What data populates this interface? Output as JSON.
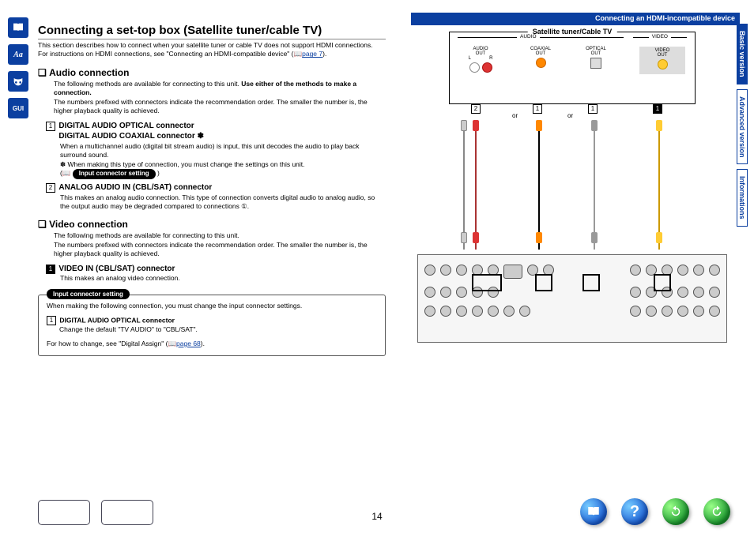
{
  "header": {
    "breadcrumb": "Connecting an HDMI-incompatible device"
  },
  "sidetabs": {
    "basic": "Basic version",
    "advanced": "Advanced version",
    "info": "Informations"
  },
  "title": "Connecting a set-top box (Satellite tuner/cable TV)",
  "intro": {
    "l1": "This section describes how to connect when your satellite tuner or cable TV does not support HDMI connections.",
    "l2a": "For instructions on HDMI connections, see \"Connecting an HDMI-compatible device\" (",
    "l2link": "page 7",
    "l2b": ")."
  },
  "audio": {
    "heading": "Audio connection",
    "p1a": "The following methods are available for connecting to this unit. ",
    "p1b": "Use either of the methods to make a connection.",
    "p2": "The numbers prefixed with connectors indicate the recommendation order. The smaller the number is, the higher playback quality is achieved.",
    "item1": {
      "num": "1",
      "t1": "DIGITAL AUDIO OPTICAL connector",
      "t2": "DIGITAL AUDIO COAXIAL connector ✽",
      "d1": "When a multichannel audio (digital bit stream audio) is input, this unit decodes the audio to play back surround sound.",
      "d2": "✽ When making this type of connection, you must change the settings on this unit.",
      "pill": "Input connector setting"
    },
    "item2": {
      "num": "2",
      "t": "ANALOG AUDIO IN (CBL/SAT) connector",
      "d": "This makes an analog audio connection. This type of connection converts digital audio to analog audio, so the output audio may be degraded compared to connections ①."
    }
  },
  "video": {
    "heading": "Video connection",
    "p1": "The following methods are available for connecting to this unit.",
    "p2": "The numbers prefixed with connectors indicate the recommendation order. The smaller the number is, the higher playback quality is achieved.",
    "item1": {
      "num": "1",
      "t": "VIDEO IN (CBL/SAT) connector",
      "d": "This makes an analog video connection."
    }
  },
  "infobox": {
    "pill": "Input connector setting",
    "p1": "When making the following connection, you must change the input connector settings.",
    "num": "1",
    "t": "DIGITAL AUDIO OPTICAL connector",
    "d": "Change the default \"TV AUDIO\" to \"CBL/SAT\".",
    "p2a": "For how to change, see \"Digital Assign\" (",
    "p2link": "page 68",
    "p2b": ")."
  },
  "diagram": {
    "stb_title": "Satellite tuner/Cable TV",
    "groups": {
      "audio": "AUDIO",
      "video": "VIDEO",
      "audio_out": "AUDIO\nOUT",
      "l": "L",
      "r": "R",
      "coax": "COAXIAL\nOUT",
      "opt": "OPTICAL\nOUT",
      "vout": "VIDEO\nOUT"
    },
    "idx": {
      "a2": "2",
      "a1a": "1",
      "a1b": "1",
      "v1": "1"
    },
    "or": "or"
  },
  "pagenum": "14",
  "nav": {
    "book": "book-icon",
    "help": "help-icon",
    "back": "back-icon",
    "fwd": "forward-icon",
    "thumb1": "receiver-front-thumb",
    "thumb2": "receiver-rear-thumb"
  }
}
